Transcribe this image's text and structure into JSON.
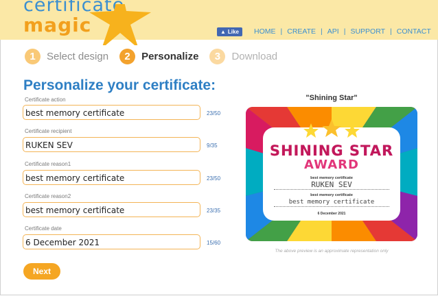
{
  "header": {
    "logo_line1": "certificate",
    "logo_line2": "magic",
    "like_label": "Like",
    "nav": [
      "HOME",
      "CREATE",
      "API",
      "SUPPORT",
      "CONTACT"
    ]
  },
  "steps": [
    {
      "num": "1",
      "label": "Select design"
    },
    {
      "num": "2",
      "label": "Personalize"
    },
    {
      "num": "3",
      "label": "Download"
    }
  ],
  "page_title": "Personalize your certificate:",
  "fields": [
    {
      "label": "Certificate action",
      "value": "best memory certificate",
      "count": "23/50"
    },
    {
      "label": "Certificate recipient",
      "value": "RUKEN SEV",
      "count": "9/35"
    },
    {
      "label": "Certificate reason1",
      "value": "best memory certificate",
      "count": "23/50"
    },
    {
      "label": "Certificate reason2",
      "value": "best memory certificate",
      "count": "23/35"
    },
    {
      "label": "Certificate date",
      "value": "6 December 2021",
      "count": "15/60"
    }
  ],
  "next_label": "Next",
  "preview": {
    "title": "\"Shining Star\"",
    "cert_title_line1": "SHINING STAR",
    "cert_title_line2": "AWARD",
    "action": "best memory certificate",
    "recipient": "RUKEN SEV",
    "reason1": "best memory certificate",
    "reason2": "best memory certificate",
    "date": "6 December 2021",
    "note": "The above preview is an approximate representation only"
  },
  "colors": {
    "header_bg": "#fbe8a6",
    "link_blue": "#3b8fd0",
    "accent_orange": "#f5a623",
    "field_border": "#f3b354",
    "facebook_blue": "#4267b2"
  }
}
